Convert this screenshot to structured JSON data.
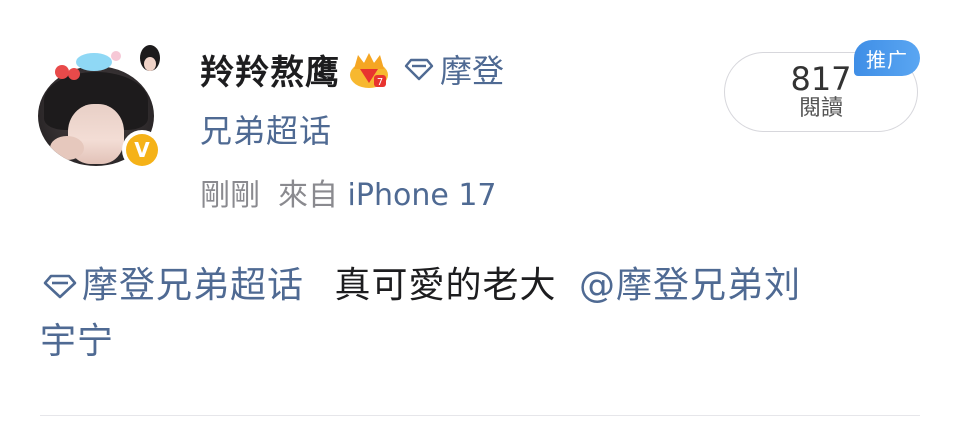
{
  "post": {
    "username": "羚羚熬鹰",
    "topic_prefix": "摩登",
    "topic_suffix": "兄弟超话",
    "time": "剛剛",
    "source_prefix": "來自",
    "source_device": "iPhone 17",
    "read_count": "817",
    "read_label": "閱讀",
    "promo_label": "推广",
    "verified_glyph": "V",
    "body_topic": "摩登兄弟超话",
    "body_text": "真可愛的老大",
    "body_mention_line1": "@摩登兄弟刘",
    "body_mention_line2": "宇宁"
  },
  "colors": {
    "link": "#4f6a93",
    "verified": "#f5b218",
    "promo": "#3f8ee6"
  },
  "icons": {
    "diamond": "diamond-icon",
    "crown": "crown-badge-icon",
    "verified": "verified-badge-icon"
  }
}
